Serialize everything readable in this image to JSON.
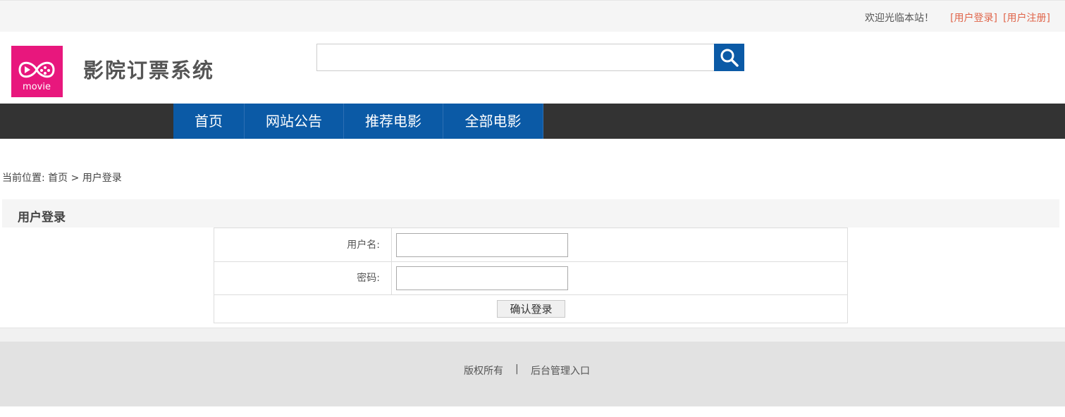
{
  "topbar": {
    "welcome": "欢迎光临本站！",
    "login_link": "[用户登录]",
    "register_link": "[用户注册]"
  },
  "header": {
    "logo_text": "movie",
    "site_title": "影院订票系统",
    "search": {
      "value": "",
      "placeholder": ""
    },
    "search_icon": "search-icon"
  },
  "nav": {
    "items": [
      {
        "label": "首页"
      },
      {
        "label": "网站公告"
      },
      {
        "label": "推荐电影"
      },
      {
        "label": "全部电影"
      }
    ]
  },
  "breadcrumb": {
    "prefix": "当前位置:",
    "home": "首页",
    "separator": ">",
    "current": "用户登录"
  },
  "panel": {
    "title": "用户登录"
  },
  "form": {
    "username_label": "用户名:",
    "username_value": "",
    "password_label": "密码:",
    "password_value": "",
    "submit_label": "确认登录"
  },
  "footer": {
    "copyright": "版权所有",
    "separator": "|",
    "admin_link": "后台管理入口"
  },
  "colors": {
    "accent": "#0b5aa6",
    "navbar": "#333333",
    "logo": "#e8177d",
    "link": "#e0654a"
  }
}
